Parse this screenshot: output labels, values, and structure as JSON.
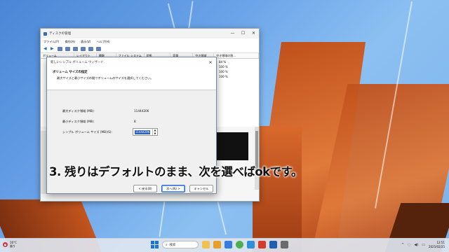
{
  "window": {
    "title": "ディスクの管理",
    "controls": [
      "—",
      "☐",
      "✕"
    ],
    "menu": [
      "ファイル(F)",
      "操作(A)",
      "表示(V)",
      "ヘルプ(H)"
    ],
    "columns": [
      "ボリューム",
      "レイアウト",
      "種類",
      "ファイル システム",
      "状態",
      "容量",
      "空き領域",
      "空き領域の割..."
    ],
    "percent_values": [
      "84 %",
      "100 %",
      "100 %",
      "100 %"
    ]
  },
  "wizard": {
    "title": "新しいシンプル ボリューム ウィザード",
    "close": "✕",
    "heading": "ボリューム サイズの指定",
    "subheading": "最大サイズと最小サイズの間でボリュームのサイズを選択してください。",
    "fields": [
      {
        "label": "最大ディスク領域 (MB):",
        "value": "11444206"
      },
      {
        "label": "最小ディスク領域 (MB):",
        "value": "8"
      }
    ],
    "size_label": "シンプル ボリューム サイズ (MB)(S):",
    "size_value": "11444206",
    "buttons": {
      "back": "< 戻る(B)",
      "next": "次へ(N) >",
      "cancel": "キャンセル"
    }
  },
  "caption": "3. 残りはデフォルトのまま、次を選べばokです。",
  "taskbar": {
    "weather_temp": "16°C",
    "weather_desc": "曇り",
    "search_placeholder": "検索",
    "time": "12:51",
    "date": "2025/02/25"
  },
  "colors": {
    "accent": "#2a5fb4",
    "taskbar": "#dee6f0"
  }
}
